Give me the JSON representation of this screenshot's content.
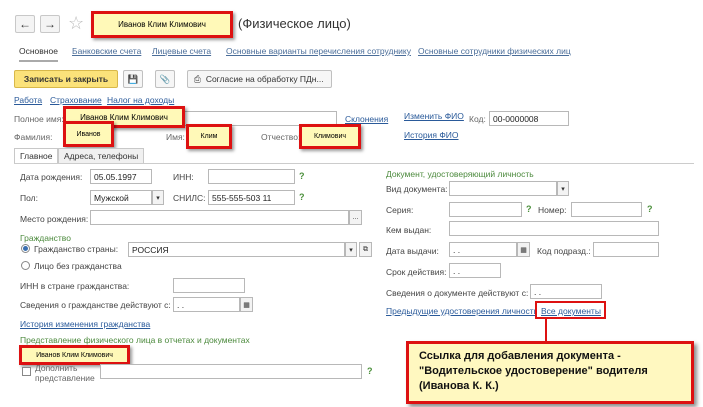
{
  "header": {
    "back_icon": "arrow-left-icon",
    "forward_icon": "arrow-right-icon",
    "star_icon": "star-icon",
    "name_highlight": "Иванов Клим Климович",
    "title_suffix": "(Физическое лицо)"
  },
  "tabs": [
    {
      "label": "Основное",
      "active": true
    },
    {
      "label": "Банковские счета"
    },
    {
      "label": "Лицевые счета"
    },
    {
      "label": "Основные варианты перечисления сотруднику"
    },
    {
      "label": "Основные сотрудники физических лиц"
    }
  ],
  "toolbar": {
    "save_close": "Записать и закрыть",
    "save_icon": "floppy-disk-icon",
    "attach_icon": "paperclip-icon",
    "print_icon": "printer-icon",
    "consent": "Согласие на обработку ПДн..."
  },
  "links_row": {
    "work": "Работа",
    "insurance": "Страхование",
    "income_tax": "Налог на доходы"
  },
  "person": {
    "full_name_label": "Полное имя:",
    "full_name_value": "Иванов Клим Климович",
    "declensions": "Склонения",
    "change_fio": "Изменить ФИО",
    "code_label": "Код:",
    "code_value": "00-0000008",
    "lastname_label": "Фамилия:",
    "lastname_value": "Иванов",
    "firstname_label": "Имя:",
    "firstname_value": "Клим",
    "patronymic_label": "Отчество:",
    "patronymic_value": "Климович",
    "fio_history": "История ФИО"
  },
  "inner_tabs": [
    {
      "label": "Главное",
      "active": true
    },
    {
      "label": "Адреса, телефоны"
    }
  ],
  "left": {
    "birth_label": "Дата рождения:",
    "birth_value": "05.05.1997",
    "inn_label": "ИНН:",
    "inn_value": "",
    "gender_label": "Пол:",
    "gender_value": "Мужской",
    "snils_label": "СНИЛС:",
    "snils_value": "555-555-503 11",
    "birthplace_label": "Место рождения:",
    "birthplace_value": "",
    "citizenship_header": "Гражданство",
    "citizen_country_label": "Гражданство страны:",
    "citizen_country_value": "РОССИЯ",
    "stateless_label": "Лицо без гражданства",
    "foreign_inn_label": "ИНН в стране гражданства:",
    "foreign_inn_value": "",
    "citizenship_from_label": "Сведения о гражданстве действуют с:",
    "citizenship_from_value": " .  .",
    "citizenship_history": "История изменения гражданства",
    "representation_header": "Представление физического лица в отчетах и документах",
    "representation_value": "Иванов Клим Климович",
    "supplement_label": "Дополнить представление"
  },
  "right": {
    "doc_header": "Документ, удостоверяющий личность",
    "doc_type_label": "Вид документа:",
    "doc_type_value": "",
    "series_label": "Серия:",
    "series_value": "",
    "number_label": "Номер:",
    "number_value": "",
    "issued_by_label": "Кем выдан:",
    "issued_by_value": "",
    "issue_date_label": "Дата выдачи:",
    "issue_date_value": " .  .",
    "dept_code_label": "Код подразд.:",
    "dept_code_value": "",
    "validity_label": "Срок действия:",
    "validity_value": " .  .",
    "doc_from_label": "Сведения о документе действуют с:",
    "doc_from_value": " .  .",
    "prev_docs": "Предыдущие удостоверения личности",
    "all_docs": "Все документы"
  },
  "callout": {
    "text": "Ссылка для добавления документа - \"Водительское удостоверение\" водителя (Иванова К. К.)"
  },
  "colors": {
    "highlight_border": "#dd1111",
    "highlight_fill": "#fff9b8",
    "primary_button": "#fbe27a",
    "link": "#2a5a9a",
    "green_text": "#4c8a3d"
  }
}
